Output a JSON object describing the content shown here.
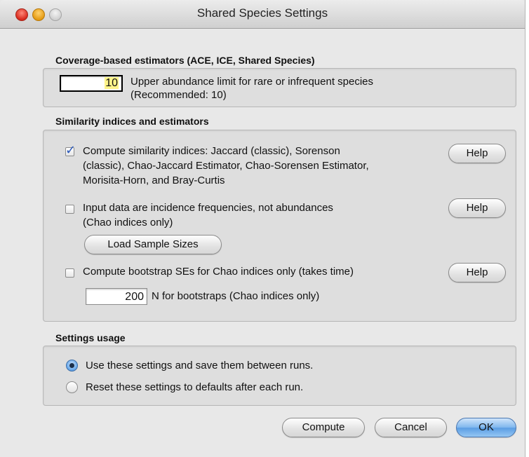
{
  "window": {
    "title": "Shared Species Settings"
  },
  "coverage": {
    "header": "Coverage-based estimators (ACE, ICE, Shared Species)",
    "limit_value": "10",
    "limit_label_line1": "Upper abundance limit for rare or infrequent species",
    "limit_label_line2": "(Recommended: 10)"
  },
  "similarity": {
    "header": "Similarity indices and estimators",
    "compute_indices": {
      "checked": true,
      "line1": "Compute similarity indices: Jaccard (classic), Sorenson",
      "line2": "(classic), Chao-Jaccard Estimator, Chao-Sorensen Estimator,",
      "line3": "Morisita-Horn, and Bray-Curtis",
      "help_label": "Help"
    },
    "incidence": {
      "checked": false,
      "line1": "Input data are incidence frequencies, not abundances",
      "line2": "(Chao indices only)",
      "help_label": "Help",
      "load_button_label": "Load Sample Sizes"
    },
    "bootstrap": {
      "checked": false,
      "label": "Compute bootstrap SEs for Chao indices only (takes time)",
      "help_label": "Help",
      "n_value": "200",
      "n_label": "N for bootstraps (Chao indices only)"
    }
  },
  "settings_usage": {
    "header": "Settings usage",
    "options": [
      {
        "label": "Use these settings and save them between runs.",
        "selected": true
      },
      {
        "label": "Reset these settings to defaults after each run.",
        "selected": false
      }
    ]
  },
  "footer": {
    "compute_label": "Compute",
    "cancel_label": "Cancel",
    "ok_label": "OK"
  },
  "colors": {
    "accent": "#5a9de3",
    "focus_highlight": "#fff48a"
  }
}
